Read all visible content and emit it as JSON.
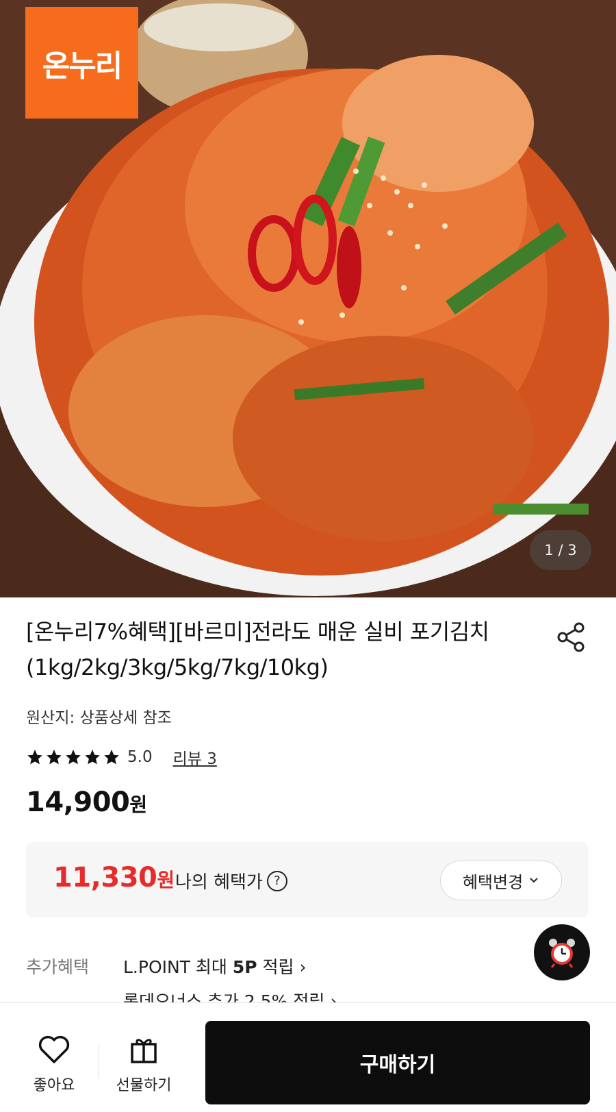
{
  "hero": {
    "brand_logo_text": "온누리",
    "image_counter": "1 / 3"
  },
  "product": {
    "title": "[온누리7%혜택][바르미]전라도 매운 실비 포기김치(1kg/2kg/3kg/5kg/7kg/10kg)",
    "origin": "원산지: 상품상세 참조",
    "rating": "5.0",
    "rating_stars": 5,
    "review_link": "리뷰 3",
    "price": "14,900",
    "price_unit": "원"
  },
  "benefit": {
    "price": "11,330",
    "price_unit": "원",
    "label": "나의 혜택가",
    "help_icon": "?",
    "change_button": "혜택변경"
  },
  "extra": {
    "label": "추가혜택",
    "line1_prefix": "L.POINT 최대 ",
    "line1_bold": "5P",
    "line1_suffix": " 적립",
    "line2": "롯데오너스 추가 2.5% 적립"
  },
  "bottom_bar": {
    "like_label": "좋아요",
    "gift_label": "선물하기",
    "buy_label": "구매하기"
  },
  "colors": {
    "brand": "#f76b1c",
    "benefit_price": "#e62b2b",
    "buy_button": "#0d0d0d"
  }
}
